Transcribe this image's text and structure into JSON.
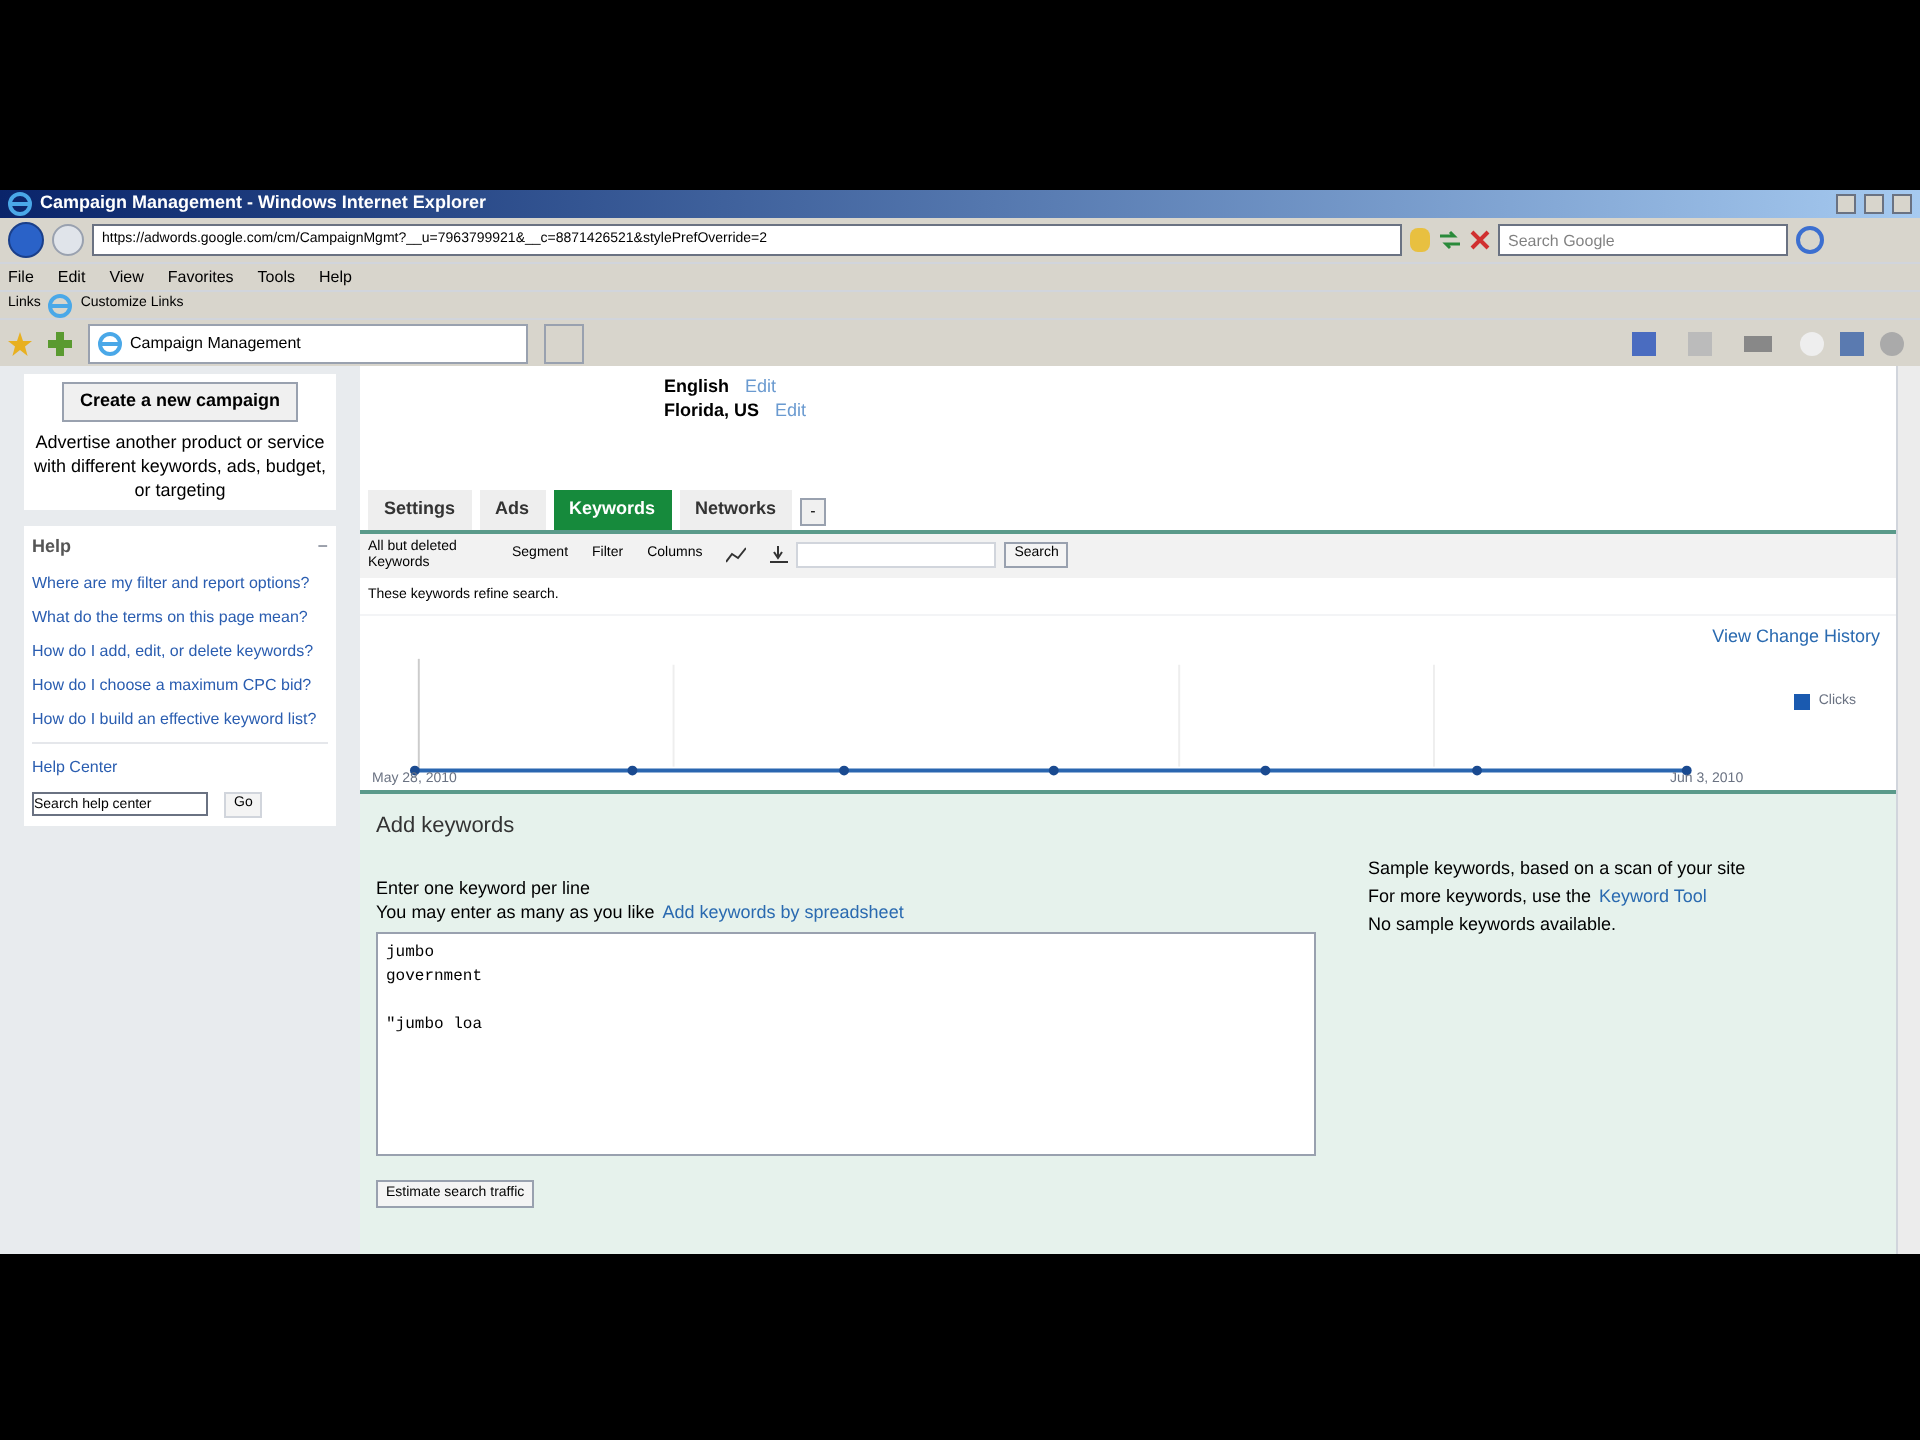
{
  "window": {
    "title": "Campaign Management - Windows Internet Explorer",
    "address": "https://adwords.google.com/cm/CampaignMgmt?__u=7963799921&__c=8871426521&stylePrefOverride=2",
    "search_placeholder": "Search Google",
    "menu": [
      "File",
      "Edit",
      "View",
      "Favorites",
      "Tools",
      "Help"
    ],
    "links_label": "Links",
    "links": [
      "Customize Links"
    ],
    "tab": "Campaign Management"
  },
  "sidebar": {
    "create_button": "Create a new campaign",
    "description": "Advertise another product or service with different keywords, ads, budget, or targeting",
    "help": {
      "title": "Help",
      "collapse": "−",
      "links": [
        "Where are my filter and report options?",
        "What do the terms on this page mean?",
        "How do I add, edit, or delete keywords?",
        "How do I choose a maximum CPC bid?",
        "How do I build an effective keyword list?"
      ],
      "help_center": "Help Center",
      "search_placeholder": "Search help center",
      "go": "Go"
    }
  },
  "campaign_info": [
    {
      "label": "English",
      "edit": "Edit"
    },
    {
      "label": "Florida, US",
      "edit": "Edit"
    }
  ],
  "tabs": [
    {
      "label": "Settings",
      "selected": false
    },
    {
      "label": "Ads",
      "selected": false
    },
    {
      "label": "Keywords",
      "selected": true
    },
    {
      "label": "Networks",
      "selected": false
    }
  ],
  "tabs_more": "-",
  "toolbar": {
    "view": "All but deleted Keywords",
    "segment": "Segment",
    "filter": "Filter",
    "columns": "Columns",
    "search_button": "Search"
  },
  "note": "These keywords refine search.",
  "chart": {
    "history_link": "View Change History",
    "legend": "Clicks",
    "start_label": "May 28, 2010",
    "end_label": "Jun 3, 2010"
  },
  "add_keywords": {
    "title": "Add keywords",
    "line1": "Enter one keyword per line",
    "line2": "You may enter as many as you like",
    "spreadsheet_link": "Add keywords by spreadsheet",
    "value": "jumbo\ngovernment\n\n\"jumbo loa",
    "estimate_button": "Estimate search traffic",
    "samples_line1": "Sample keywords, based on a scan of your site",
    "samples_line2": "For more keywords, use the",
    "keyword_tool_link": "Keyword Tool",
    "samples_line3": "No sample keywords available."
  }
}
